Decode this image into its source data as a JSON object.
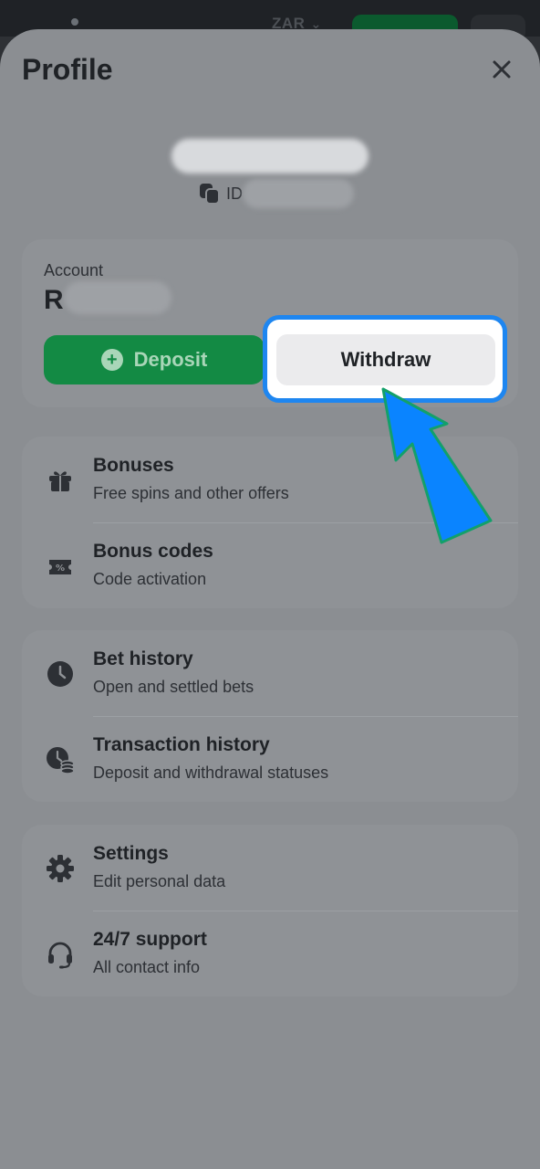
{
  "topbar": {
    "currency": "ZAR"
  },
  "profile": {
    "title": "Profile",
    "id_label": "ID"
  },
  "account": {
    "label": "Account",
    "currency_symbol": "R",
    "deposit_label": "Deposit",
    "withdraw_label": "Withdraw"
  },
  "menu": {
    "bonuses": {
      "title": "Bonuses",
      "subtitle": "Free spins and other offers"
    },
    "bonus_codes": {
      "title": "Bonus codes",
      "subtitle": "Code activation"
    },
    "bet_history": {
      "title": "Bet history",
      "subtitle": "Open and settled bets"
    },
    "transaction_history": {
      "title": "Transaction history",
      "subtitle": "Deposit and withdrawal statuses"
    },
    "settings": {
      "title": "Settings",
      "subtitle": "Edit personal data"
    },
    "support": {
      "title": "24/7 support",
      "subtitle": "All contact info"
    }
  },
  "colors": {
    "accent_green": "#138a44",
    "highlight_blue": "#1e86f0",
    "arrow_blue": "#0a84ff"
  }
}
